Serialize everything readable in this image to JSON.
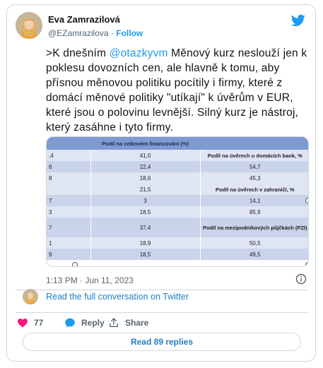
{
  "author": {
    "name": "Eva Zamrazilová",
    "handle": "@EZamrazilova",
    "separator": "·",
    "follow_label": "Follow"
  },
  "tweet": {
    "text_before": ">K dnešním ",
    "mention": "@otazkyvm",
    "text_after": " Měnový kurz neslouží jen k poklesu dovozních cen, ale hlavně k tomu,  aby přísnou měnovou politiku pocítily i firmy, které z domácí měnové politiky \"utíkají\" k úvěrům v EUR, které jsou o polovinu levnější. Silný kurz je nástroj, který zasáhne i tyto firmy."
  },
  "media": {
    "header": "Podíl na celkovém financování (%)",
    "rows": [
      {
        "c1": ",4",
        "c2": "41,0",
        "c3": "Podíl na úvěrech u domácích bank, %",
        "c3_is_label": true
      },
      {
        "c1": "6",
        "c2": "22,4",
        "c3": "54,7"
      },
      {
        "c1": "8",
        "c2": "18,6",
        "c3": "45,3"
      },
      {
        "c1": "",
        "c2": "21,5",
        "c3": "Podíl na úvěrech v zahraničí, %",
        "c3_is_label": true
      },
      {
        "c1": "7",
        "c2": "3",
        "c3": "14,1"
      },
      {
        "c1": "3",
        "c2": "18,5",
        "c3": "85,9"
      },
      {
        "c1": "7",
        "c2": "37,4",
        "c3": "Podíl na mezipodnikových půjčkách (PZI)",
        "c3_is_label": true
      },
      {
        "c1": "1",
        "c2": "18,9",
        "c3": "50,5"
      },
      {
        "c1": "9",
        "c2": "18,5",
        "c3": "49,5"
      }
    ]
  },
  "timestamp": "1:13 PM · Jun 11, 2023",
  "conversation_link": "Read the full conversation on Twitter",
  "actions": {
    "like_count": "77",
    "reply_label": "Reply",
    "share_label": "Share"
  },
  "read_replies_label": "Read 89 replies",
  "icons": [
    "twitter-bird-icon",
    "info-icon",
    "heart-icon",
    "reply-bubble-icon",
    "share-icon"
  ],
  "colors": {
    "accent": "#1d9bf0",
    "like": "#f91880",
    "muted": "#536471",
    "table_header": "#7f9ad2"
  }
}
